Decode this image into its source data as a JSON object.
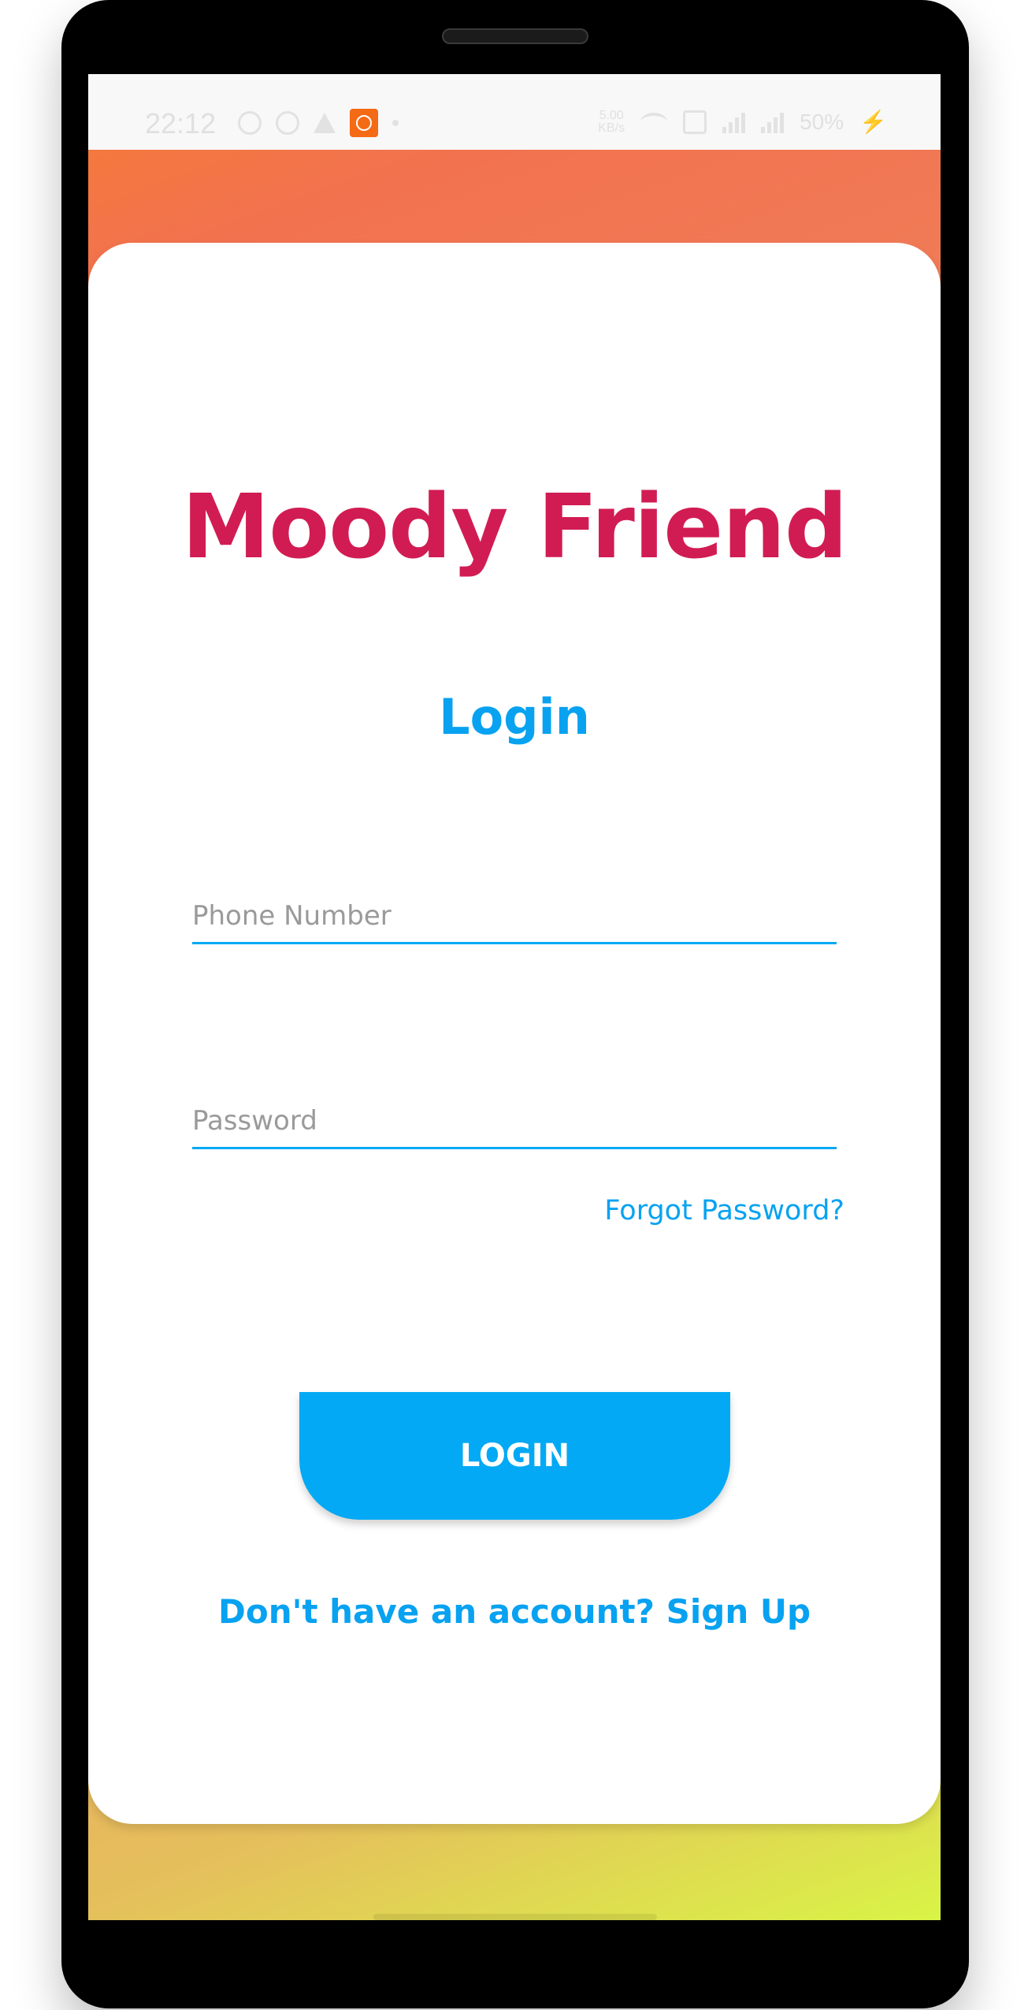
{
  "status_bar": {
    "time": "22:12",
    "network_speed": "5.00\nKB/s",
    "battery": "50%",
    "icons": [
      "settings-icon",
      "whatsapp-icon",
      "warning-icon",
      "mi-app-icon",
      "dot-icon",
      "wifi-icon",
      "volte-icon",
      "signal-icon",
      "signal-icon",
      "charging-icon"
    ]
  },
  "app": {
    "title": "Moody Friend",
    "heading": "Login"
  },
  "form": {
    "phone_placeholder": "Phone Number",
    "phone_value": "",
    "password_placeholder": "Password",
    "password_value": "",
    "forgot_label": "Forgot Password?",
    "login_label": "LOGIN",
    "signup_label": "Don't have an account? Sign Up"
  },
  "colors": {
    "title": "#d11c53",
    "accent": "#03a9f4",
    "gradient_top": "#f57b35",
    "gradient_bottom": "#d9f446"
  }
}
